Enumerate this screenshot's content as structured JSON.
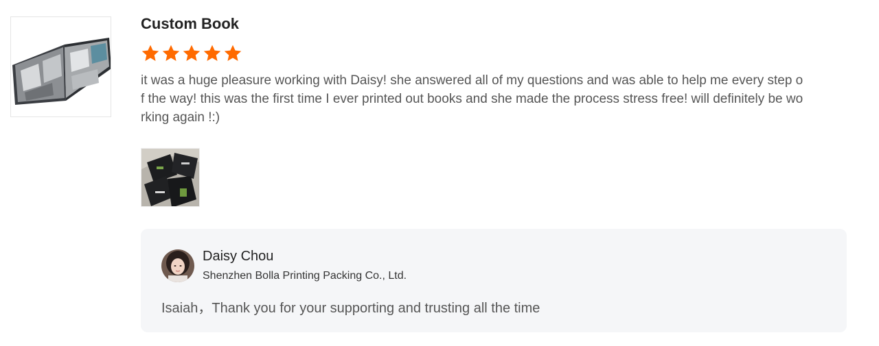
{
  "review": {
    "product_title": "Custom Book",
    "rating": 5,
    "rating_max": 5,
    "star_color": "#ff6a00",
    "text": "it was a huge pleasure working with Daisy! she answered all of my questions and was able to help me every step of the way! this was the first time I ever printed out books and she made the process stress free! will definitely be working again !:)"
  },
  "reply": {
    "name": "Daisy Chou",
    "company": "Shenzhen Bolla Printing Packing Co., Ltd.",
    "text": "Isaiah，Thank you for your supporting and trusting all the time"
  }
}
